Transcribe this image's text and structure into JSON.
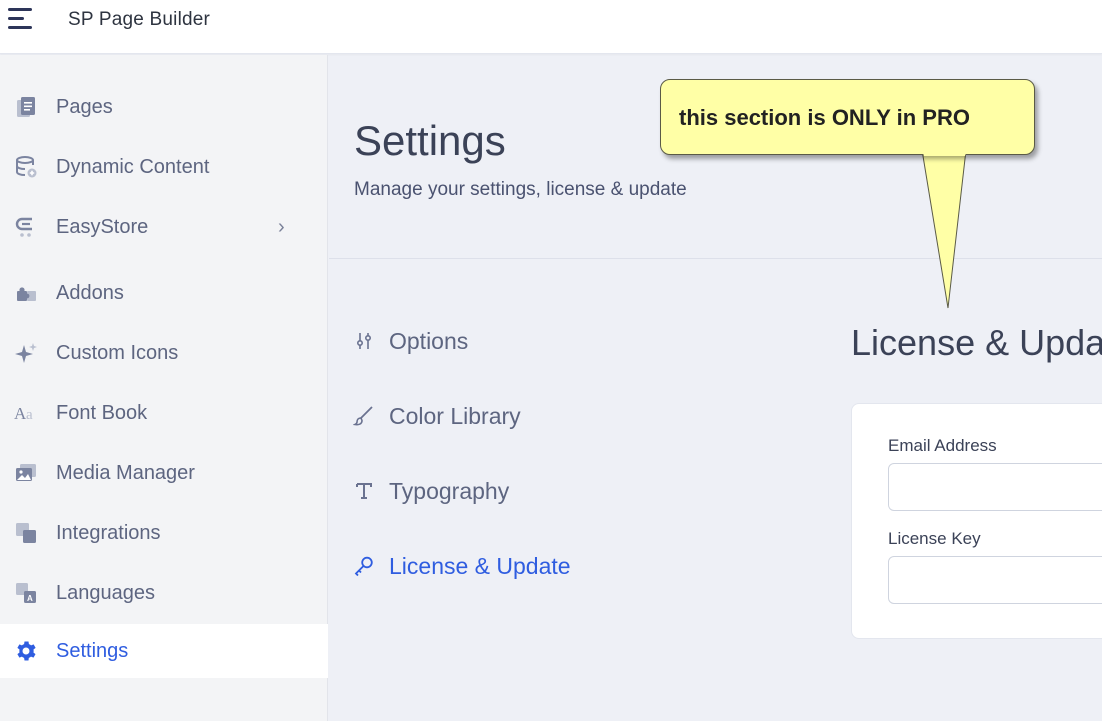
{
  "app": {
    "title": "SP Page Builder"
  },
  "sidebar": {
    "items": [
      {
        "label": "Pages"
      },
      {
        "label": "Dynamic Content"
      },
      {
        "label": "EasyStore"
      },
      {
        "label": "Addons"
      },
      {
        "label": "Custom Icons"
      },
      {
        "label": "Font Book"
      },
      {
        "label": "Media Manager"
      },
      {
        "label": "Integrations"
      },
      {
        "label": "Languages"
      },
      {
        "label": "Settings"
      }
    ],
    "active": "Settings"
  },
  "header": {
    "title": "Settings",
    "subtitle": "Manage your settings, license & update"
  },
  "tabs": [
    {
      "label": "Options"
    },
    {
      "label": "Color Library"
    },
    {
      "label": "Typography"
    },
    {
      "label": "License & Update"
    }
  ],
  "section": {
    "title": "License & Upda",
    "email_label": "Email Address",
    "license_label": "License Key",
    "email_value": "",
    "license_value": ""
  },
  "callout": {
    "text": "this section is ONLY in PRO"
  },
  "colors": {
    "accent": "#2f5de0",
    "sidebar_bg": "#f3f4f6",
    "main_bg": "#eef0f6",
    "callout_bg": "#ffffa6"
  }
}
